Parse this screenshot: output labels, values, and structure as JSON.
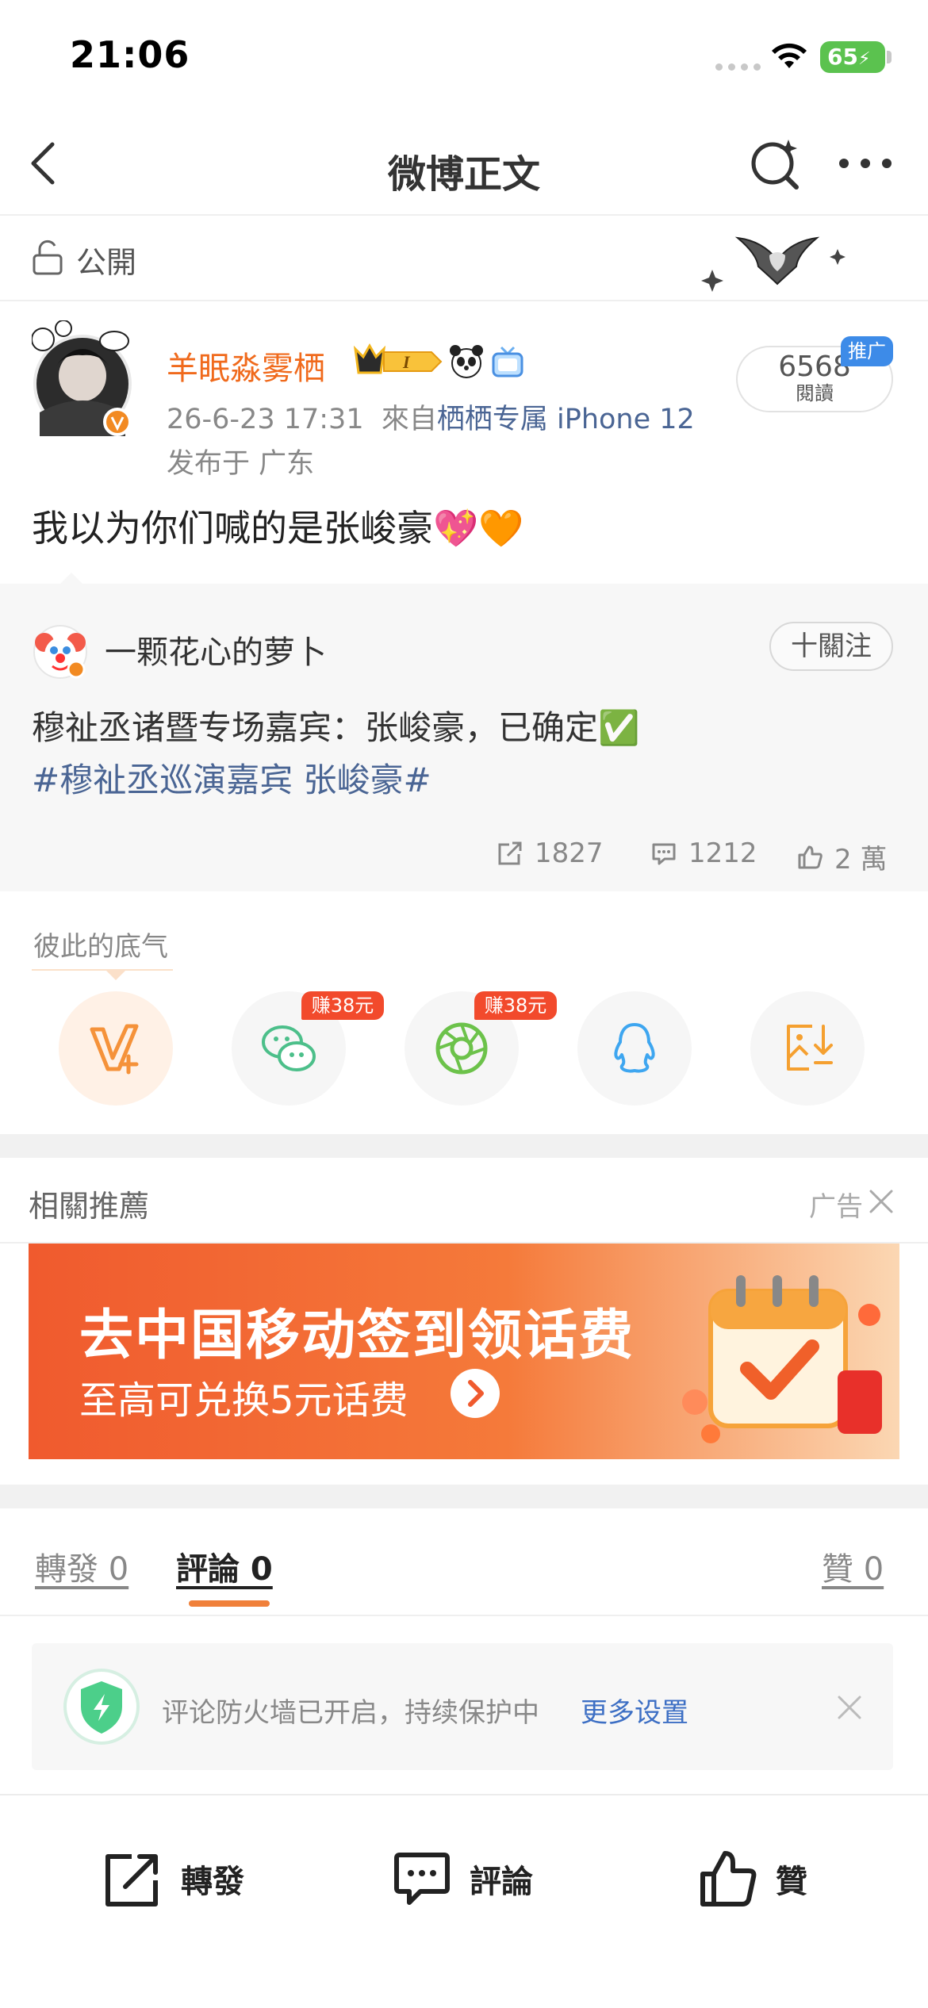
{
  "status_bar": {
    "time": "21:06",
    "battery": "65"
  },
  "nav": {
    "title": "微博正文"
  },
  "visibility": {
    "label": "公開"
  },
  "post": {
    "username": "羊眠淼雾栖",
    "timestamp": "26-6-23 17:31",
    "source_prefix": "來自",
    "source": "栖栖专属 iPhone 12",
    "location": "发布于 广东",
    "reads_count": "6568",
    "reads_label": "閱讀",
    "promo_badge": "推广",
    "content": "我以为你们喊的是张峻豪💖🧡"
  },
  "repost": {
    "username": "一颗花心的萝卜",
    "follow_label": "十關注",
    "text": "穆祉丞诸暨专场嘉宾：张峻豪，已确定✅",
    "hashtag": "#穆祉丞巡演嘉宾 张峻豪#",
    "reposts": "1827",
    "comments": "1212",
    "likes": "2 萬"
  },
  "share": {
    "label": "彼此的底气",
    "earn_badge_1": "赚38元",
    "earn_badge_2": "赚38元",
    "icons": [
      "vplus-icon",
      "wechat-icon",
      "moments-icon",
      "qq-icon",
      "save-image-icon"
    ]
  },
  "related": {
    "title": "相關推薦",
    "ad_label": "广告",
    "banner_title": "去中国移动签到领话费",
    "banner_subtitle": "至高可兑换5元话费"
  },
  "tabs": {
    "repost": "轉發 0",
    "comment": "評論 0",
    "like": "贊 0"
  },
  "firewall": {
    "text": "评论防火墙已开启，持续保护中",
    "link": "更多设置"
  },
  "bottom_bar": {
    "repost": "轉發",
    "comment": "評論",
    "like": "贊"
  },
  "colors": {
    "accent": "#f06a1c",
    "link": "#4a6594",
    "earn": "#f24a2c",
    "promo": "#3d8be8"
  }
}
